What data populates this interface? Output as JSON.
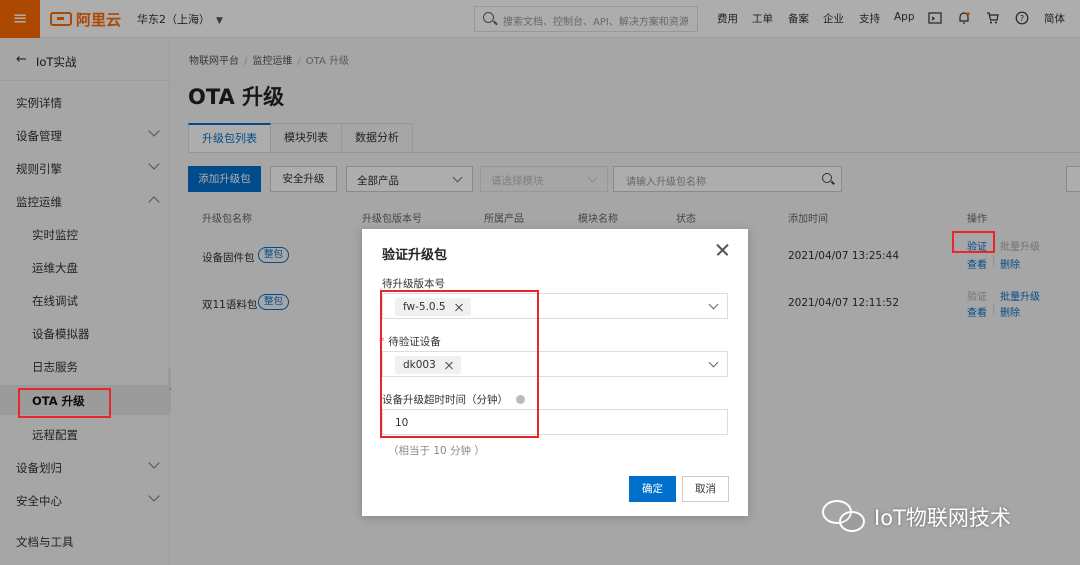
{
  "topbar": {
    "brand": "阿里云",
    "region": "华东2（上海）",
    "search_placeholder": "搜索文档、控制台、API、解决方案和资源",
    "nav": [
      "费用",
      "工单",
      "备案",
      "企业",
      "支持",
      "App"
    ],
    "lang": "简体"
  },
  "sidebar": {
    "back_label": "IoT实战",
    "items": [
      {
        "label": "实例详情"
      },
      {
        "label": "设备管理"
      },
      {
        "label": "规则引擎"
      },
      {
        "label": "监控运维"
      },
      {
        "label": "实时监控"
      },
      {
        "label": "运维大盘"
      },
      {
        "label": "在线调试"
      },
      {
        "label": "设备模拟器"
      },
      {
        "label": "日志服务"
      },
      {
        "label": "OTA 升级"
      },
      {
        "label": "远程配置"
      },
      {
        "label": "设备划归"
      },
      {
        "label": "安全中心"
      },
      {
        "label": "文档与工具"
      }
    ]
  },
  "breadcrumb": [
    "物联网平台",
    "监控运维",
    "OTA 升级"
  ],
  "page_title": "OTA 升级",
  "tabs": [
    "升级包列表",
    "模块列表",
    "数据分析"
  ],
  "toolbar": {
    "add_label": "添加升级包",
    "secure_label": "安全升级",
    "product_select": "全部产品",
    "module_placeholder": "请选择模块",
    "search_placeholder": "请输入升级包名称"
  },
  "table": {
    "headers": [
      "升级包名称",
      "升级包版本号",
      "所属产品",
      "模块名称",
      "状态",
      "添加时间",
      "操作"
    ],
    "rows": [
      {
        "name": "设备固件包",
        "badge": "整包",
        "time": "2021/04/07 13:25:44",
        "op_verify": "验证",
        "op_batch": "批量升级",
        "op_view": "查看",
        "op_delete": "删除"
      },
      {
        "name": "双11语料包",
        "badge": "整包",
        "time": "2021/04/07 12:11:52",
        "op_verify": "验证",
        "op_batch": "批量升级",
        "op_view": "查看",
        "op_delete": "删除"
      }
    ]
  },
  "dialog": {
    "title": "验证升级包",
    "version_label": "待升级版本号",
    "version_tag": "fw-5.0.5",
    "device_label": "待验证设备",
    "device_tag": "dk003",
    "timeout_label": "设备升级超时时间（分钟）",
    "timeout_value": "10",
    "hint": "（相当于 10 分钟 ）",
    "ok_label": "确定",
    "cancel_label": "取消"
  },
  "watermark": "IoT物联网技术",
  "colors": {
    "brand": "#ff6a00",
    "primary": "#0070cc",
    "highlight": "#e8262b"
  }
}
